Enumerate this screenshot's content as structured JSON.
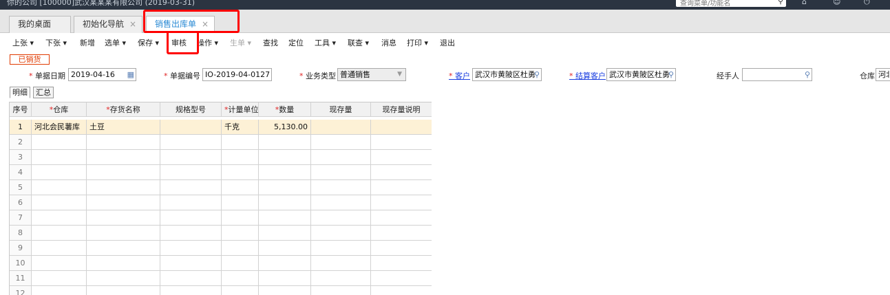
{
  "topbar": {
    "title": "你的公司    [100000]武汉某某某有限公司    (2019-03-31)",
    "search_text": "查询菜单/功能名",
    "icons": [
      "search-icon",
      "home-icon",
      "user-icon",
      "power-icon"
    ]
  },
  "tabs": [
    {
      "label": "我的桌面",
      "closable": false
    },
    {
      "label": "初始化导航",
      "close": "×"
    },
    {
      "label": "销售出库单",
      "close": "×",
      "active": true
    }
  ],
  "toolbar": {
    "items": [
      {
        "label": "上张 ▾"
      },
      {
        "label": "下张 ▾"
      },
      {
        "label": "新增"
      },
      {
        "label": "选单 ▾"
      },
      {
        "label": "保存 ▾"
      },
      {
        "label": "审核"
      },
      {
        "label": "操作 ▾"
      },
      {
        "label": "生单 ▾",
        "disabled": true
      },
      {
        "label": "查找"
      },
      {
        "label": "定位"
      },
      {
        "label": "工具 ▾"
      },
      {
        "label": "联查 ▾"
      },
      {
        "label": "消息"
      },
      {
        "label": "打印 ▾"
      },
      {
        "label": "退出"
      }
    ]
  },
  "status": "已销货",
  "fields": {
    "date": {
      "label": "单据日期",
      "value": "2019-04-16"
    },
    "number": {
      "label": "单据编号",
      "value": "IO-2019-04-0127"
    },
    "biz_type": {
      "label": "业务类型",
      "value": "普通销售"
    },
    "customer": {
      "label": "客户",
      "value": "武汉市黄陂区杜勇"
    },
    "settle_customer": {
      "label": "结算客户",
      "value": "武汉市黄陂区杜勇"
    },
    "handler": {
      "label": "经手人",
      "value": ""
    },
    "warehouse": {
      "label": "仓库",
      "value": "河北"
    }
  },
  "subtabs": [
    "明细",
    "汇总"
  ],
  "grid": {
    "columns": [
      {
        "label": "序号",
        "required": false
      },
      {
        "label": "仓库",
        "required": true
      },
      {
        "label": "存货名称",
        "required": true
      },
      {
        "label": "规格型号",
        "required": false
      },
      {
        "label": "计量单位",
        "required": true
      },
      {
        "label": "数量",
        "required": true
      },
      {
        "label": "现存量",
        "required": false
      },
      {
        "label": "现存量说明",
        "required": false
      }
    ],
    "rows": [
      {
        "no": "1",
        "warehouse": "河北会民薯库",
        "item": "土豆",
        "spec": "",
        "unit": "千克",
        "qty": "5,130.00",
        "stock": "",
        "stock_note": ""
      },
      {
        "no": "2"
      },
      {
        "no": "3"
      },
      {
        "no": "4"
      },
      {
        "no": "5"
      },
      {
        "no": "6"
      },
      {
        "no": "7"
      },
      {
        "no": "8"
      },
      {
        "no": "9"
      },
      {
        "no": "10"
      },
      {
        "no": "11"
      },
      {
        "no": "12"
      }
    ]
  },
  "colors": {
    "accent": "#2a8ad4",
    "highlight": "#ff0000",
    "status": "#e03a00",
    "selected_row": "#fdf1d6",
    "link": "#1a3ee0"
  }
}
